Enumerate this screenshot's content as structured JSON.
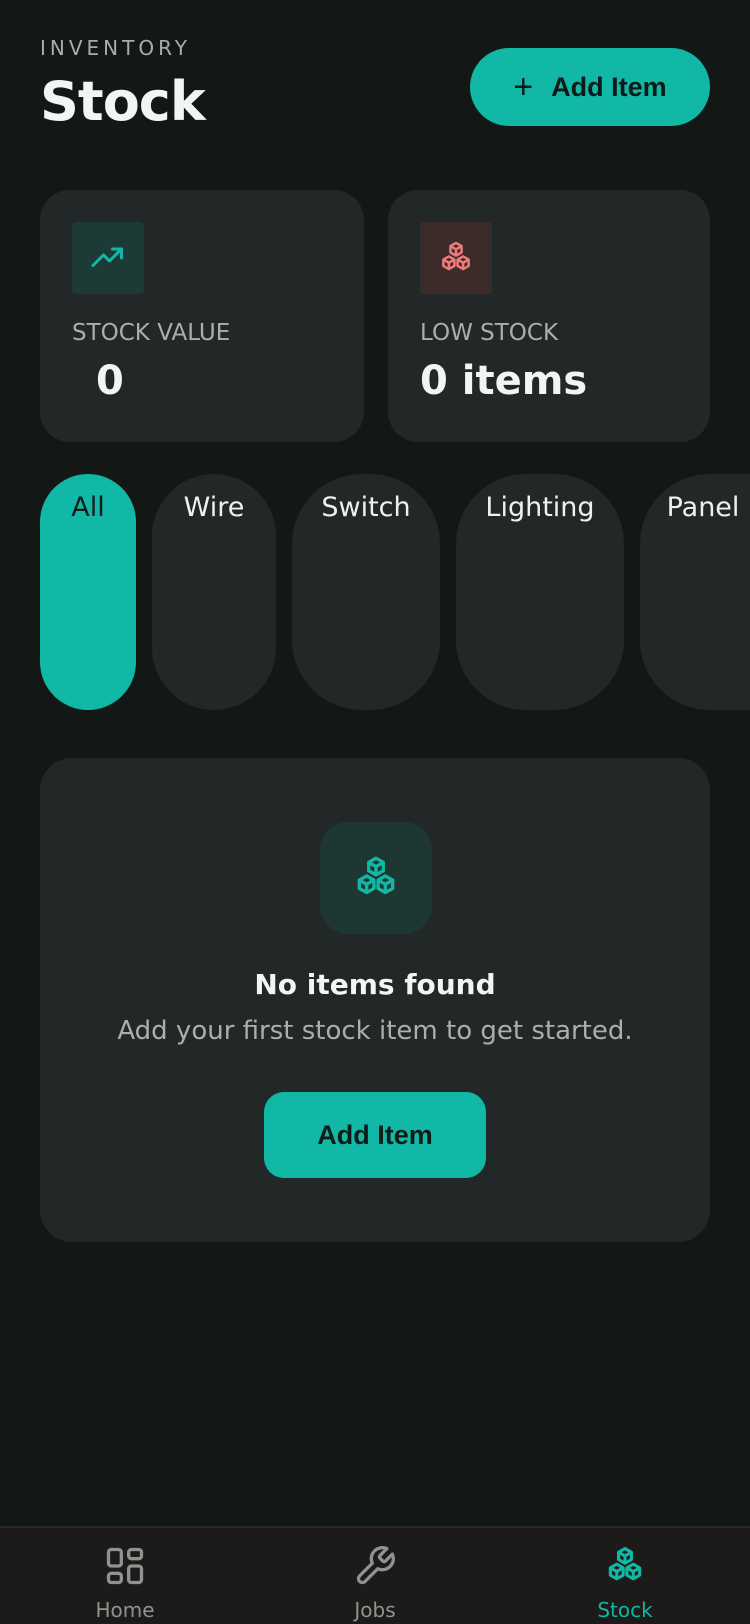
{
  "header": {
    "kicker": "INVENTORY",
    "title": "Stock",
    "add_button_icon": "plus-icon",
    "add_button_label": "Add Item"
  },
  "stats": {
    "stock_value": {
      "icon": "trending-up-icon",
      "label": "STOCK VALUE",
      "value": "0"
    },
    "low_stock": {
      "icon": "boxes-icon",
      "label": "LOW STOCK",
      "value": "0 items"
    }
  },
  "filters": {
    "selected": "All",
    "items": [
      "All",
      "Wire",
      "Switch",
      "Lighting",
      "Panel"
    ]
  },
  "empty_state": {
    "icon": "boxes-icon",
    "title": "No items found",
    "subtitle": "Add your first stock item to get started.",
    "button_label": "Add Item"
  },
  "nav": {
    "active": "Stock",
    "items": [
      {
        "label": "Home",
        "icon": "grid-icon"
      },
      {
        "label": "Jobs",
        "icon": "wrench-icon"
      },
      {
        "label": "Stock",
        "icon": "boxes-icon"
      }
    ]
  },
  "colors": {
    "background": "#131817",
    "card": "#212827",
    "accent": "#11b8a5",
    "danger": "#f07a7a",
    "muted": "#a9afad"
  }
}
